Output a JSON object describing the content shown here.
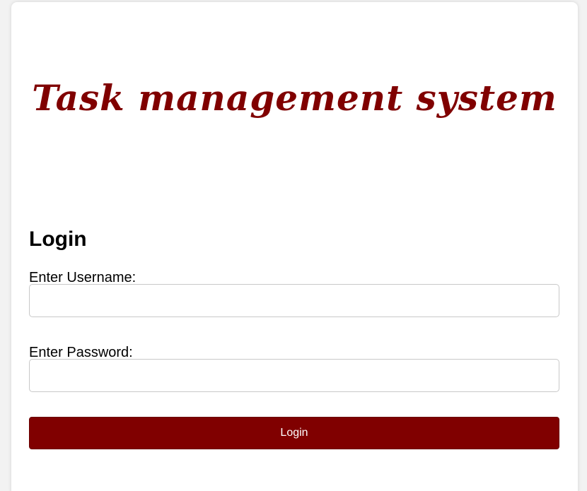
{
  "header": {
    "app_title": "Task management system"
  },
  "login_form": {
    "heading": "Login",
    "username_label": "Enter Username:",
    "username_value": "",
    "password_label": "Enter Password:",
    "password_value": "",
    "submit_label": "Login"
  },
  "colors": {
    "brand": "#800000",
    "background": "#f2f2f2",
    "card": "#ffffff"
  }
}
